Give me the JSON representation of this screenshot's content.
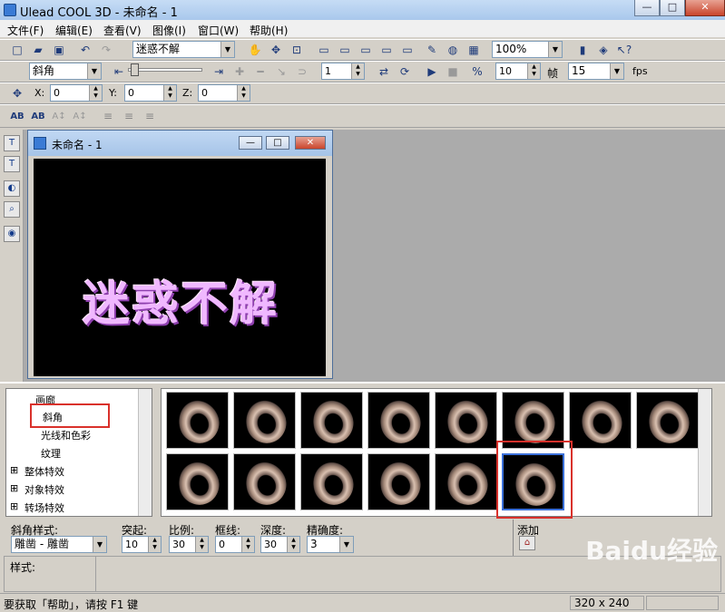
{
  "window": {
    "title": "Ulead COOL 3D - 未命名 - 1",
    "min": "—",
    "max": "□",
    "close": "✕"
  },
  "menu": [
    "文件(F)",
    "编辑(E)",
    "查看(V)",
    "图像(I)",
    "窗口(W)",
    "帮助(H)"
  ],
  "toolbar1": {
    "text_combo": "迷惑不解",
    "zoom": "100%"
  },
  "toolbar2": {
    "effect_combo": "斜角",
    "frame": "1",
    "frames": "10",
    "frame_label": "帧",
    "fps_value": "15",
    "fps_label": "fps"
  },
  "toolbar3": {
    "x_label": "X:",
    "x": "0",
    "y_label": "Y:",
    "y": "0",
    "z_label": "Z:",
    "z": "0"
  },
  "child": {
    "title": "未命名 - 1",
    "canvas_text": "迷惑不解"
  },
  "tree": {
    "items": [
      "画廊",
      "斜角",
      "光线和色彩",
      "纹理",
      "整体特效",
      "对象特效",
      "转场特效"
    ]
  },
  "props": {
    "bevel_style_label": "斜角样式:",
    "bevel_style": "雕凿 - 雕凿",
    "protrude_label": "突起:",
    "protrude": "10",
    "scale_label": "比例:",
    "scale": "30",
    "border_label": "框线:",
    "border": "0",
    "depth_label": "深度:",
    "depth": "30",
    "precision_label": "精确度:",
    "precision": "3",
    "add_label": "添加"
  },
  "style_label": "样式:",
  "status": {
    "help": "要获取「帮助」，请按 F1 键",
    "size": "320 x 240"
  },
  "watermark": "Baidu经验"
}
